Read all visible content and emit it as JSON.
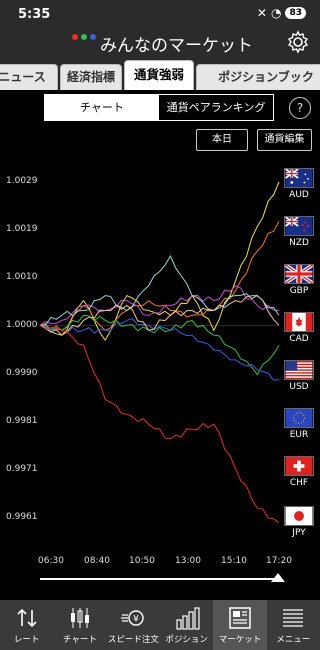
{
  "status": {
    "time": "5:35",
    "battery": "83"
  },
  "header": {
    "title": "みんなのマーケット"
  },
  "tabs": [
    {
      "label": "ニュース"
    },
    {
      "label": "経済指標"
    },
    {
      "label": "通貨強弱"
    },
    {
      "label": "ポジションブック"
    }
  ],
  "segment": {
    "chart": "チャート",
    "ranking": "通貨ペアランキング"
  },
  "help": "?",
  "buttons": {
    "today": "本日",
    "edit": "通貨編集"
  },
  "chart_data": {
    "type": "line",
    "x_ticks": [
      "06:30",
      "08:40",
      "10:50",
      "13:00",
      "15:10",
      "17:20"
    ],
    "y_ticks": [
      "1.0029",
      "1.0019",
      "1.0010",
      "1.0000",
      "0.9990",
      "0.9981",
      "0.9971",
      "0.9961"
    ],
    "series": [
      {
        "name": "AUD",
        "color": "#f5e03a",
        "values": [
          1.0,
          0.9998,
          1.0005,
          0.9997,
          1.0006,
          1.0003,
          1.0002,
          1.0006,
          0.9999,
          1.0009,
          1.002,
          1.0029
        ]
      },
      {
        "name": "NZD",
        "color": "#f07a2a",
        "values": [
          1.0,
          0.9999,
          1.0004,
          0.9999,
          1.0003,
          1.0005,
          1.0003,
          1.0002,
          1.0003,
          1.0007,
          1.0015,
          1.0021
        ]
      },
      {
        "name": "GBP",
        "color": "#c44fd6",
        "values": [
          1.0,
          1.0001,
          1.0004,
          1.0003,
          1.0005,
          1.0002,
          1.0004,
          1.0006,
          1.0005,
          1.0008,
          1.0004,
          1.0003
        ]
      },
      {
        "name": "CAD",
        "color": "#2ec24a",
        "values": [
          1.0,
          0.9999,
          1.0002,
          1.0001,
          1.0,
          0.9999,
          0.9999,
          1.0001,
          0.9998,
          0.9995,
          0.999,
          0.9996
        ]
      },
      {
        "name": "USD",
        "color": "#3a5fe0",
        "values": [
          1.0,
          0.9999,
          0.9999,
          0.9999,
          1.0001,
          1.0,
          0.9999,
          0.9998,
          0.9995,
          0.9993,
          0.9991,
          0.9989
        ]
      },
      {
        "name": "EUR",
        "color": "#9ad8d8",
        "values": [
          1.0,
          1.0002,
          1.0003,
          1.0006,
          1.0003,
          1.0008,
          1.0014,
          1.0006,
          1.0003,
          1.0006,
          1.0006,
          1.0002
        ]
      },
      {
        "name": "CHF",
        "color": "#f5c0a8",
        "values": [
          1.0,
          0.9998,
          1.0001,
          1.0003,
          1.0004,
          0.9999,
          1.0002,
          1.0003,
          1.0003,
          1.0005,
          1.0006,
          1.0
        ]
      },
      {
        "name": "JPY",
        "color": "#e83020",
        "values": [
          1.0,
          0.9999,
          0.9996,
          0.9985,
          0.9982,
          0.998,
          0.9977,
          0.9979,
          0.998,
          0.9971,
          0.9963,
          0.996
        ]
      }
    ]
  },
  "flags": [
    {
      "code": "AUD"
    },
    {
      "code": "NZD"
    },
    {
      "code": "GBP"
    },
    {
      "code": "CAD"
    },
    {
      "code": "USD"
    },
    {
      "code": "EUR"
    },
    {
      "code": "CHF"
    },
    {
      "code": "JPY"
    }
  ],
  "nav": [
    {
      "label": "レート",
      "icon": "arrows-icon"
    },
    {
      "label": "チャート",
      "icon": "candle-icon"
    },
    {
      "label": "スピード注文",
      "icon": "speed-order-icon"
    },
    {
      "label": "ポジション",
      "icon": "position-bars-icon"
    },
    {
      "label": "マーケット",
      "icon": "newspaper-icon"
    },
    {
      "label": "メニュー",
      "icon": "menu-icon"
    }
  ]
}
